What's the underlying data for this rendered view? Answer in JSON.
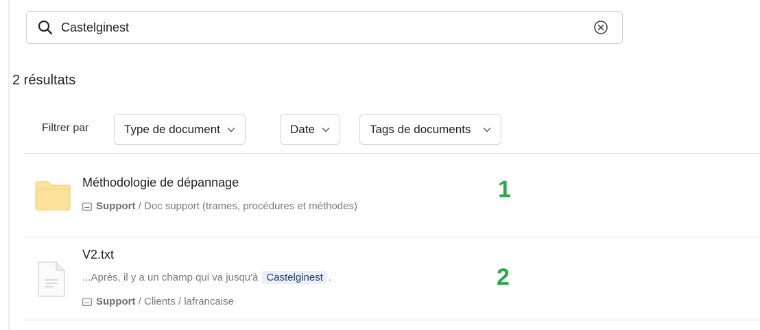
{
  "search": {
    "value": "Castelginest",
    "icon": "search-icon",
    "clear_icon": "clear-circle-x-icon"
  },
  "results_count": "2 résultats",
  "filters": {
    "label": "Filtrer par",
    "items": [
      {
        "label": "Type de document"
      },
      {
        "label": "Date"
      },
      {
        "label": "Tags de documents"
      }
    ]
  },
  "results": [
    {
      "icon": "folder-icon",
      "title": "Méthodologie de dépannage",
      "path_root": "Support",
      "path_rest": " / Doc support (trames, procédures et méthodes)",
      "annotation": "1"
    },
    {
      "icon": "text-file-icon",
      "title": "V2.txt",
      "snippet_before": "...Après, il y a un champ qui va jusqu'à",
      "snippet_match": "Castelginest",
      "snippet_after": ".",
      "path_root": "Support",
      "path_rest": " / Clients / lafrancaise",
      "annotation": "2"
    }
  ],
  "colors": {
    "annotation_green": "#2aa84a",
    "folder_yellow": "#fde39a",
    "highlight_bg": "#e8efff"
  }
}
